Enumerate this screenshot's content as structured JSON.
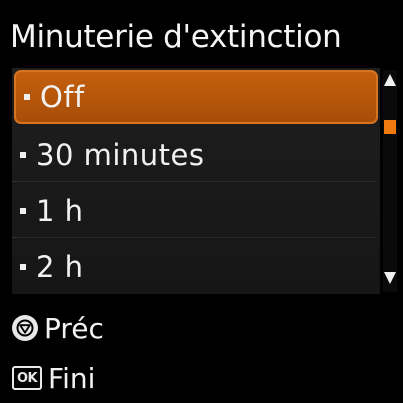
{
  "header": {
    "title": "Minuterie d'extinction"
  },
  "menu": {
    "selected_index": 0,
    "items": [
      {
        "label": "Off"
      },
      {
        "label": "30 minutes"
      },
      {
        "label": "1 h"
      },
      {
        "label": "2 h"
      }
    ]
  },
  "scrollbar": {
    "up_icon": "triangle-up-icon",
    "down_icon": "triangle-down-icon",
    "thumb_color": "#f07a10"
  },
  "footer": {
    "back": {
      "icon": "back-button-icon",
      "label": "Préc"
    },
    "done": {
      "icon": "ok-button-icon",
      "icon_text": "OK",
      "label": "Fini"
    }
  },
  "colors": {
    "accent": "#c4600e",
    "background": "#000000",
    "text": "#f2f2f2"
  }
}
